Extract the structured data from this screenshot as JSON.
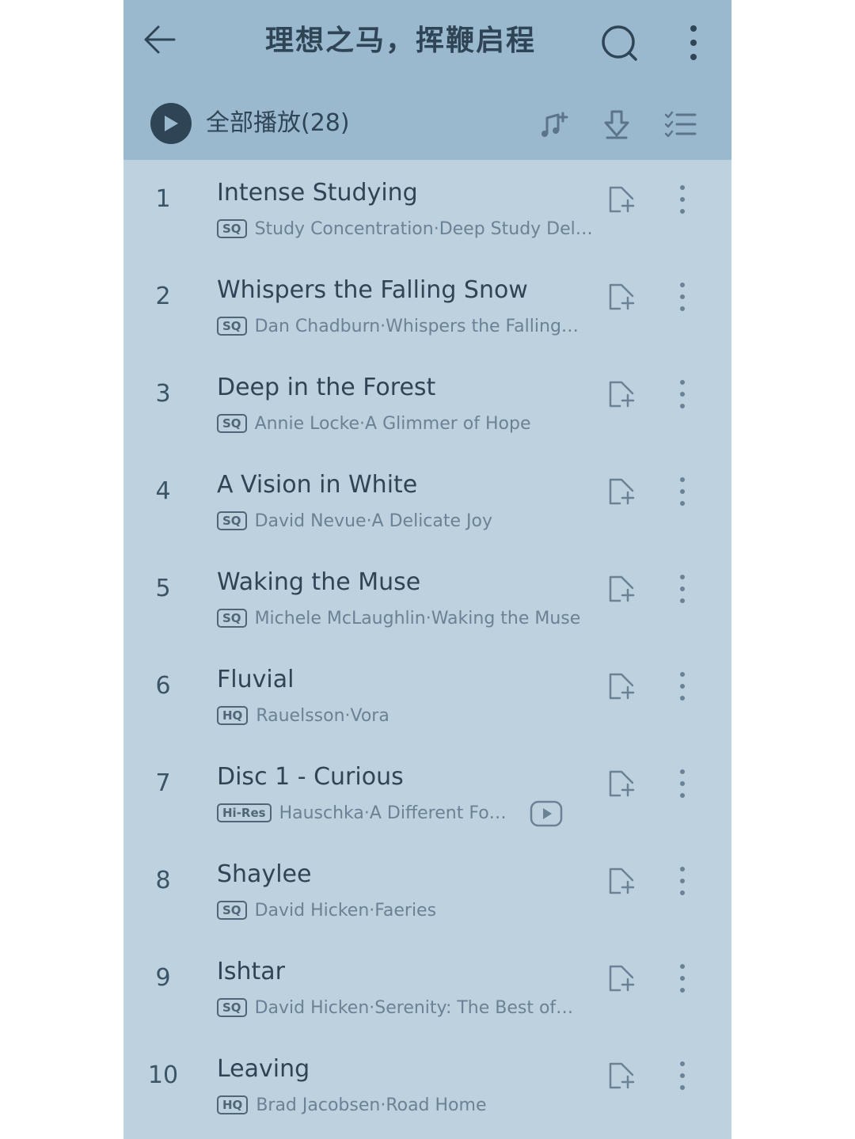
{
  "header": {
    "title": "理想之马，挥鞭启程",
    "back_icon": "arrow-left-icon",
    "search_icon": "search-icon",
    "more_icon": "more-vertical-icon"
  },
  "playall": {
    "label": "全部播放",
    "count": "(28)",
    "icons": [
      "music-note-add-icon",
      "download-icon",
      "multi-select-list-icon"
    ]
  },
  "colors": {
    "header_bg": "#9bb9ce",
    "list_bg": "#bed1de",
    "text_primary": "#2f4556",
    "text_secondary": "#6a8295"
  },
  "songs": [
    {
      "num": "1",
      "title": "Intense Studying",
      "quality": "SQ",
      "artist": "Study Concentration·Deep Study Del…"
    },
    {
      "num": "2",
      "title": "Whispers the Falling Snow",
      "quality": "SQ",
      "artist": "Dan Chadburn·Whispers the Falling…"
    },
    {
      "num": "3",
      "title": "Deep in the Forest",
      "quality": "SQ",
      "artist": "Annie Locke·A Glimmer of Hope"
    },
    {
      "num": "4",
      "title": "A Vision in White",
      "quality": "SQ",
      "artist": "David Nevue·A Delicate Joy"
    },
    {
      "num": "5",
      "title": "Waking the Muse",
      "quality": "SQ",
      "artist": "Michele McLaughlin·Waking the Muse"
    },
    {
      "num": "6",
      "title": "Fluvial",
      "quality": "HQ",
      "artist": "Rauelsson·Vora"
    },
    {
      "num": "7",
      "title": "Disc 1 - Curious",
      "quality": "Hi-Res",
      "artist": "Hauschka·A Different Fo…",
      "has_video": true
    },
    {
      "num": "8",
      "title": "Shaylee",
      "quality": "SQ",
      "artist": "David Hicken·Faeries"
    },
    {
      "num": "9",
      "title": "Ishtar",
      "quality": "SQ",
      "artist": "David Hicken·Serenity: The Best of…"
    },
    {
      "num": "10",
      "title": "Leaving",
      "quality": "HQ",
      "artist": "Brad Jacobsen·Road Home"
    }
  ]
}
